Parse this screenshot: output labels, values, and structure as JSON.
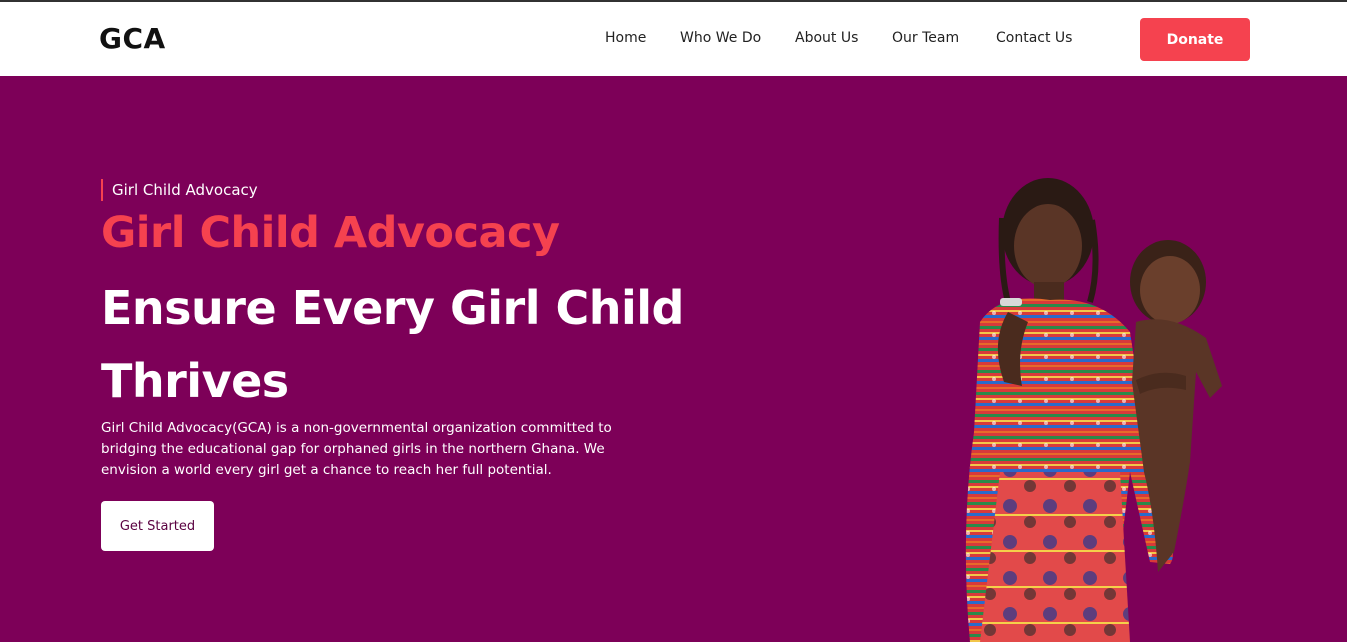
{
  "brand": {
    "logo": "GCA"
  },
  "nav": {
    "items": [
      {
        "label": "Home"
      },
      {
        "label": "Who We Do"
      },
      {
        "label": "About Us"
      },
      {
        "label": "Our Team"
      },
      {
        "label": "Contact Us"
      }
    ],
    "donate_label": "Donate"
  },
  "hero": {
    "eyebrow": "Girl Child Advocacy",
    "accent_title": "Girl Child Advocacy",
    "title": "Ensure Every Girl Child Thrives",
    "description": "Girl Child Advocacy(GCA) is a non-governmental organization committed to bridging the educational gap for orphaned girls in the northern Ghana. We envision a world every girl get a chance to reach her full potential.",
    "cta_label": "Get Started"
  },
  "colors": {
    "accent": "#f5424f",
    "hero_background": "#7d0058",
    "navbar_background": "#ffffff"
  }
}
